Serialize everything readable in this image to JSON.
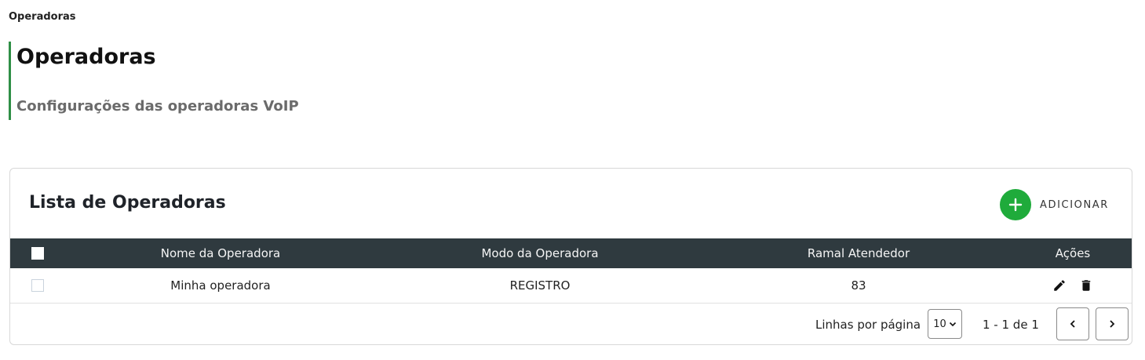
{
  "breadcrumb": "Operadoras",
  "header": {
    "title": "Operadoras",
    "subtitle": "Configurações das operadoras VoIP"
  },
  "card": {
    "title": "Lista de Operadoras",
    "add_label": "ADICIONAR",
    "add_icon": "plus-icon",
    "accent_color": "#1fab3b"
  },
  "table": {
    "columns": [
      "Nome da Operadora",
      "Modo da Operadora",
      "Ramal Atendedor",
      "Ações"
    ],
    "header_bg": "#2f3a3f",
    "rows": [
      {
        "name": "Minha operadora",
        "mode": "REGISTRO",
        "ramal": "83",
        "actions": [
          "edit-icon",
          "delete-icon"
        ]
      }
    ]
  },
  "pagination": {
    "rows_label": "Linhas por página",
    "rows_per_page": "10",
    "range": "1 - 1 de 1"
  }
}
